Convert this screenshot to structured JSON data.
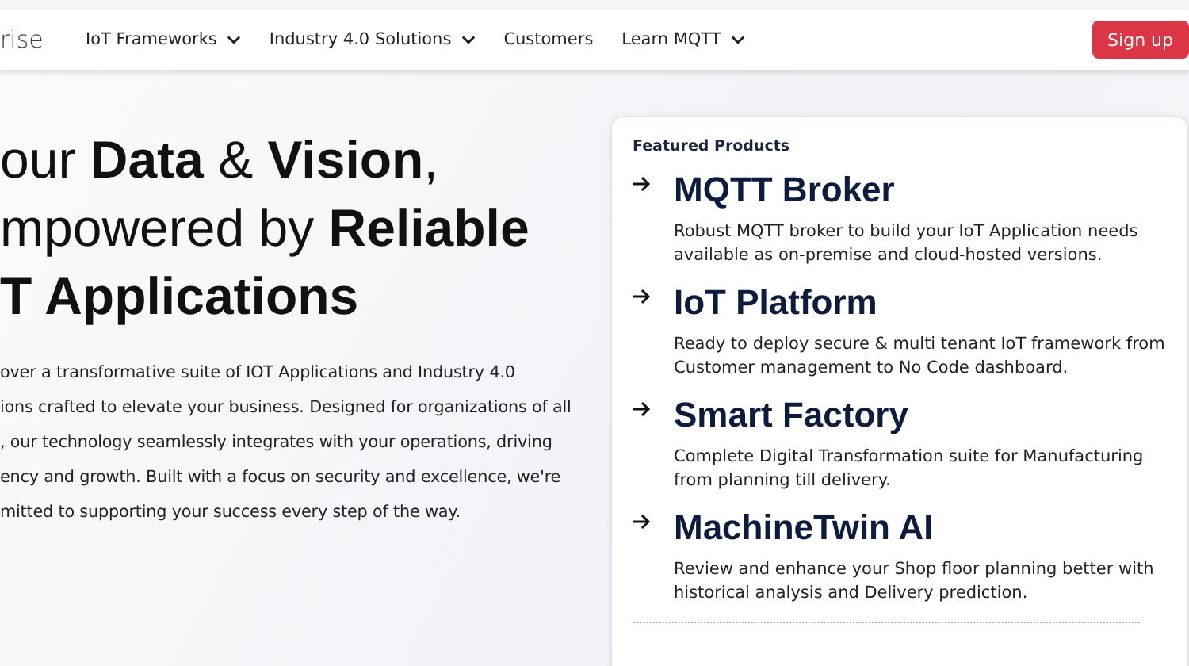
{
  "nav": {
    "logo": "rise",
    "items": [
      {
        "label": "IoT Frameworks",
        "dropdown": true
      },
      {
        "label": "Industry 4.0 Solutions",
        "dropdown": true
      },
      {
        "label": "Customers",
        "dropdown": false
      },
      {
        "label": "Learn MQTT",
        "dropdown": true
      }
    ],
    "signup": "Sign up"
  },
  "hero": {
    "headline": [
      "our **Data** & **Vision**,",
      "mpowered by **Reliable**",
      "**T Applications**"
    ],
    "paragraph": "over a transformative suite of IOT Applications and Industry 4.0\nions crafted to elevate your business. Designed for organizations of all\n, our technology seamlessly integrates with your operations, driving\nency and growth. Built with a focus on security and excellence, we're\nmitted to supporting your success every step of the way."
  },
  "featured": {
    "heading": "Featured Products",
    "products": [
      {
        "title": "MQTT Broker",
        "description": "Robust MQTT broker to build your IoT Application needs available as on-premise and cloud-hosted versions."
      },
      {
        "title": "IoT Platform",
        "description": "Ready to deploy secure & multi tenant IoT framework from Customer management to No Code dashboard."
      },
      {
        "title": "Smart Factory",
        "description": "Complete Digital Transformation suite for Manufacturing from planning till delivery."
      },
      {
        "title": "MachineTwin AI",
        "description": "Review and enhance your Shop floor planning better with historical analysis and Delivery prediction."
      }
    ]
  }
}
